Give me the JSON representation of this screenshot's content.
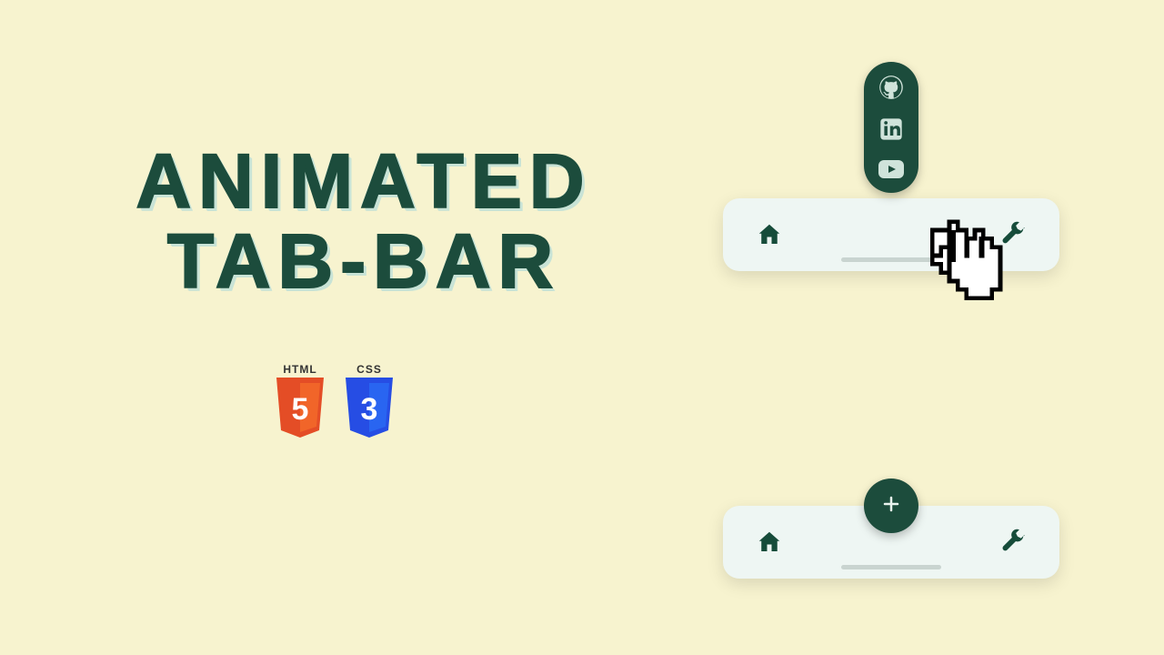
{
  "title": {
    "line1": "ANIMATED",
    "line2": "TAB-BAR"
  },
  "badges": {
    "html": {
      "label": "HTML",
      "number": "5"
    },
    "css": {
      "label": "CSS",
      "number": "3"
    }
  },
  "colors": {
    "background": "#f7f3cf",
    "accent_dark": "#1c4c3c",
    "panel": "#eef6f3",
    "html_shield": "#e44d26",
    "css_shield": "#264de4"
  },
  "tabbar": {
    "icons": {
      "home": "home-icon",
      "settings": "wrench-icon"
    },
    "expanded_social": [
      "github-icon",
      "linkedin-icon",
      "youtube-icon"
    ],
    "fab": "plus-icon"
  }
}
